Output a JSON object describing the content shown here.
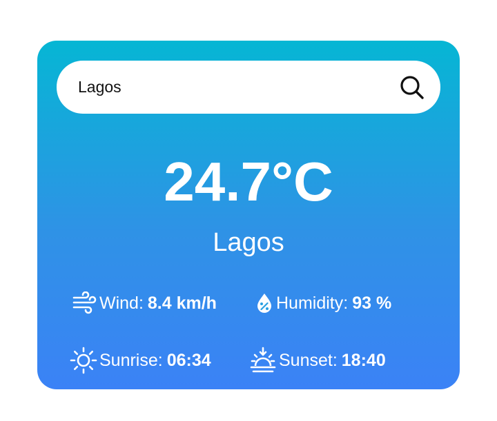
{
  "search": {
    "value": "Lagos",
    "icon": "search-icon"
  },
  "weather": {
    "temperature": "24.7°C",
    "city": "Lagos",
    "wind": {
      "label": "Wind:",
      "value": "8.4 km/h",
      "icon": "wind-icon"
    },
    "humidity": {
      "label": "Humidity:",
      "value": "93 %",
      "icon": "humidity-drop-icon"
    },
    "sunrise": {
      "label": "Sunrise:",
      "value": "06:34",
      "icon": "sunrise-sun-icon"
    },
    "sunset": {
      "label": "Sunset:",
      "value": "18:40",
      "icon": "sunset-icon"
    }
  },
  "colors": {
    "gradient_top": "#06b6d4",
    "gradient_bottom": "#3b82f6",
    "text": "#ffffff"
  }
}
